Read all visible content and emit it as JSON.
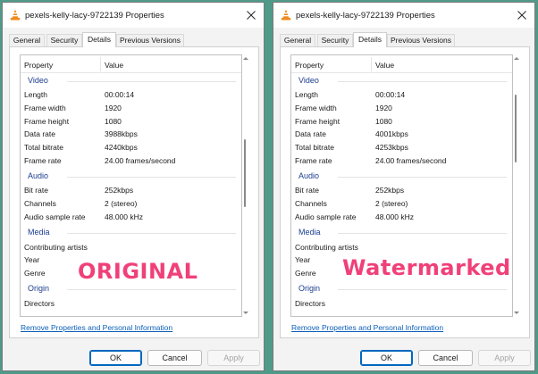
{
  "windows": [
    {
      "title": "pexels-kelly-lacy-9722139 Properties",
      "tabs": [
        {
          "label": "General"
        },
        {
          "label": "Security"
        },
        {
          "label": "Details"
        },
        {
          "label": "Previous Versions"
        }
      ],
      "header": {
        "property": "Property",
        "value": "Value"
      },
      "groups": {
        "video": "Video",
        "audio": "Audio",
        "media": "Media",
        "origin": "Origin"
      },
      "rows": {
        "length": {
          "p": "Length",
          "v": "00:00:14"
        },
        "frame_width": {
          "p": "Frame width",
          "v": "1920"
        },
        "frame_height": {
          "p": "Frame height",
          "v": "1080"
        },
        "data_rate": {
          "p": "Data rate",
          "v": "3988kbps"
        },
        "total_bitrate": {
          "p": "Total bitrate",
          "v": "4240kbps"
        },
        "frame_rate": {
          "p": "Frame rate",
          "v": "24.00 frames/second"
        },
        "bit_rate": {
          "p": "Bit rate",
          "v": "252kbps"
        },
        "channels": {
          "p": "Channels",
          "v": "2 (stereo)"
        },
        "audio_sample_rate": {
          "p": "Audio sample rate",
          "v": "48.000 kHz"
        },
        "contributing_artists": {
          "p": "Contributing artists",
          "v": ""
        },
        "year": {
          "p": "Year",
          "v": ""
        },
        "genre": {
          "p": "Genre",
          "v": ""
        },
        "directors": {
          "p": "Directors",
          "v": ""
        }
      },
      "link": "Remove Properties and Personal Information",
      "buttons": {
        "ok": "OK",
        "cancel": "Cancel",
        "apply": "Apply"
      },
      "stamp": "ORIGINAL"
    },
    {
      "title": "pexels-kelly-lacy-9722139 Properties",
      "tabs": [
        {
          "label": "General"
        },
        {
          "label": "Security"
        },
        {
          "label": "Details"
        },
        {
          "label": "Previous Versions"
        }
      ],
      "header": {
        "property": "Property",
        "value": "Value"
      },
      "groups": {
        "video": "Video",
        "audio": "Audio",
        "media": "Media",
        "origin": "Origin"
      },
      "rows": {
        "length": {
          "p": "Length",
          "v": "00:00:14"
        },
        "frame_width": {
          "p": "Frame width",
          "v": "1920"
        },
        "frame_height": {
          "p": "Frame height",
          "v": "1080"
        },
        "data_rate": {
          "p": "Data rate",
          "v": "4001kbps"
        },
        "total_bitrate": {
          "p": "Total bitrate",
          "v": "4253kbps"
        },
        "frame_rate": {
          "p": "Frame rate",
          "v": "24.00 frames/second"
        },
        "bit_rate": {
          "p": "Bit rate",
          "v": "252kbps"
        },
        "channels": {
          "p": "Channels",
          "v": "2 (stereo)"
        },
        "audio_sample_rate": {
          "p": "Audio sample rate",
          "v": "48.000 kHz"
        },
        "contributing_artists": {
          "p": "Contributing artists",
          "v": ""
        },
        "year": {
          "p": "Year",
          "v": ""
        },
        "genre": {
          "p": "Genre",
          "v": ""
        },
        "directors": {
          "p": "Directors",
          "v": ""
        }
      },
      "link": "Remove Properties and Personal Information",
      "buttons": {
        "ok": "OK",
        "cancel": "Cancel",
        "apply": "Apply"
      },
      "stamp": "Watermarked"
    }
  ],
  "icons": {
    "app": "vlc-cone-icon",
    "close": "close-icon"
  },
  "colors": {
    "desktop": "#4f9a88",
    "window": "#f3f3f3",
    "link": "#0b5fb8",
    "group_label": "#1c3d8f",
    "stamp": "#f0407a",
    "vlc_orange": "#f08a1c"
  }
}
